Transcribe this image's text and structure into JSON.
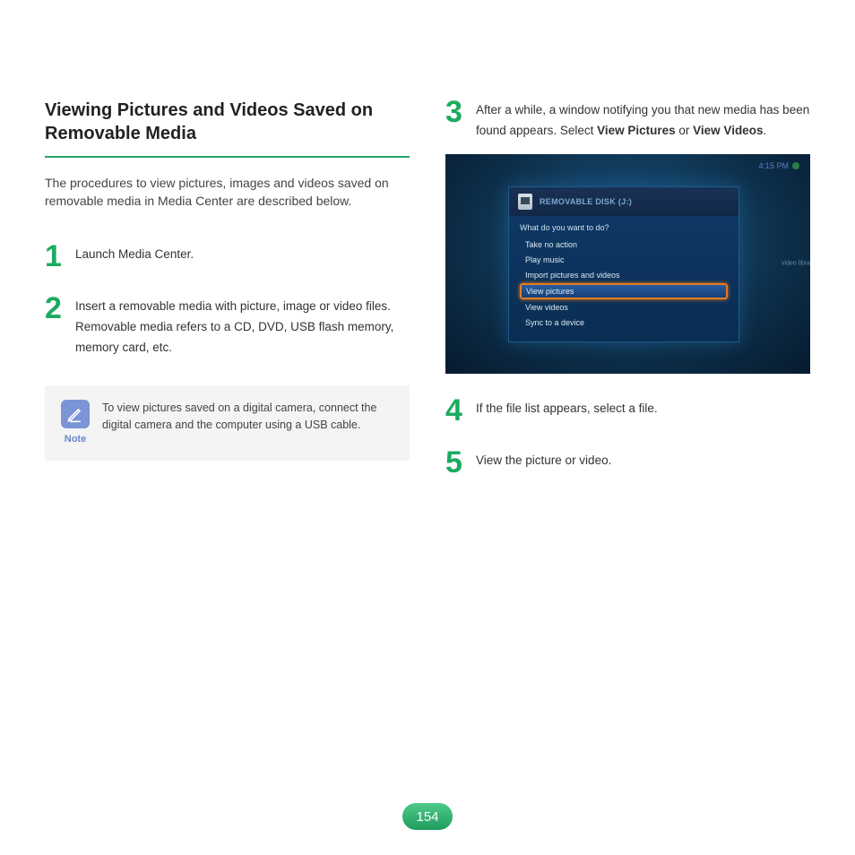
{
  "heading": "Viewing Pictures and Videos Saved on Removable Media",
  "intro": "The procedures to view pictures, images and videos saved on removable media in Media Center are described below.",
  "steps": {
    "s1": {
      "num": "1",
      "text": "Launch Media Center."
    },
    "s2": {
      "num": "2",
      "line1": "Insert a removable media with picture, image or video files.",
      "line2": "Removable media refers to a CD, DVD, USB flash memory, memory card, etc."
    },
    "s3": {
      "num": "3",
      "prefix": "After a while, a window notifying you that new media has been found appears. Select ",
      "bold1": "View Pictures",
      "mid": " or ",
      "bold2": "View Videos",
      "suffix": "."
    },
    "s4": {
      "num": "4",
      "text": "If the file list appears, select a file."
    },
    "s5": {
      "num": "5",
      "text": "View the picture or video."
    }
  },
  "note": {
    "label": "Note",
    "text": "To view pictures saved on a digital camera, connect the digital camera and the computer using a USB cable."
  },
  "screenshot": {
    "time": "4:15 PM",
    "side": "video libra",
    "dialog_title": "REMOVABLE DISK (J:)",
    "question": "What do you want to do?",
    "options": {
      "o1": "Take no action",
      "o2": "Play music",
      "o3": "Import pictures and videos",
      "o4": "View pictures",
      "o5": "View videos",
      "o6": "Sync to a device"
    }
  },
  "page_number": "154"
}
